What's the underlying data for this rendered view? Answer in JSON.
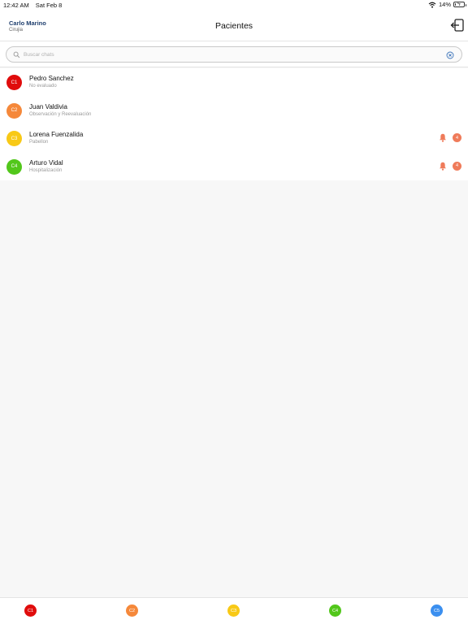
{
  "status_bar": {
    "time": "12:42 AM",
    "date": "Sat Feb 8",
    "battery": "14%",
    "battery_level": 0.14
  },
  "header": {
    "user_name": "Carlo Marino",
    "user_role": "Cirujia",
    "title": "Pacientes",
    "logout_icon": "logout-icon"
  },
  "search": {
    "placeholder": "Buscar chats",
    "value": ""
  },
  "colors": {
    "C1": "#e00c0c",
    "C2": "#f5883a",
    "C3": "#f8c916",
    "C4": "#52c71b",
    "C5": "#3b8fef",
    "badge": "#ef7b5a"
  },
  "patients": [
    {
      "code": "C1",
      "name": "Pedro Sanchez",
      "status": "No evaluado"
    },
    {
      "code": "C2",
      "name": "Juan Valdivia",
      "status": "Observación y Reevaluación"
    },
    {
      "code": "C3",
      "name": "Lorena Fuenzalida",
      "status": "Pabellon",
      "alerts": "4"
    },
    {
      "code": "C4",
      "name": "Arturo Vidal",
      "status": "Hospitalización",
      "alerts": "4"
    }
  ],
  "tabs": [
    {
      "code": "C1"
    },
    {
      "code": "C2"
    },
    {
      "code": "C3"
    },
    {
      "code": "C4"
    },
    {
      "code": "C5"
    }
  ]
}
